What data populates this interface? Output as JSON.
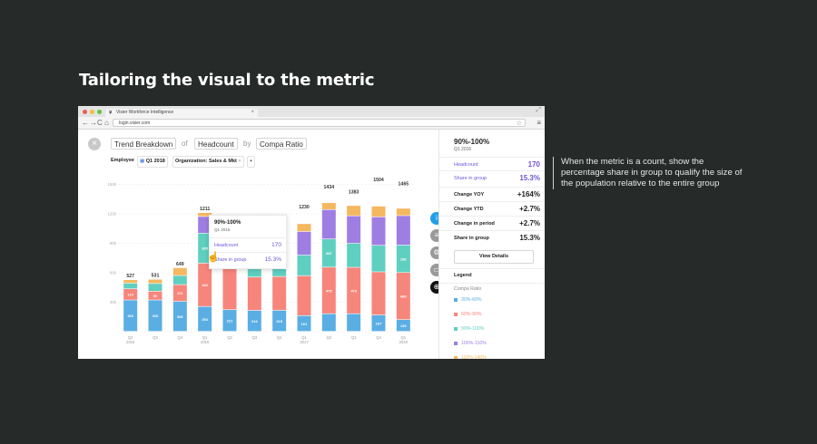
{
  "slide": {
    "title": "Tailoring the visual to the metric",
    "note": "When the metric is a count, show the percentage share in group to qualify the size of the population relative to the entire group"
  },
  "browser": {
    "tab_title": "Visier Workforce Intelligence",
    "url": "login.visier.com"
  },
  "toolbar": {
    "chart_type": "Trend Breakdown",
    "of": "of",
    "metric": "Headcount",
    "by": "by",
    "dimension": "Compa Ratio"
  },
  "filters": {
    "employee": "Employee",
    "period": "Q1 2018",
    "organization": "Organization: Sales & Mkt",
    "add": "+"
  },
  "chart_data": {
    "type": "bar",
    "stacked": true,
    "categories": [
      "Q2 2015",
      "Q3",
      "Q4",
      "Q1 2016",
      "Q2",
      "Q3",
      "Q4",
      "Q1 2017",
      "Q2",
      "Q3",
      "Q4",
      "Q1 2018"
    ],
    "x_tick_lines": [
      [
        "Q2",
        "2015"
      ],
      [
        "Q3",
        ""
      ],
      [
        "Q4",
        ""
      ],
      [
        "Q1",
        "2016"
      ],
      [
        "Q2",
        ""
      ],
      [
        "Q3",
        ""
      ],
      [
        "Q4",
        ""
      ],
      [
        "Q1",
        "2017"
      ],
      [
        "Q2",
        ""
      ],
      [
        "Q3",
        ""
      ],
      [
        "Q4",
        ""
      ],
      [
        "Q1",
        "2018"
      ]
    ],
    "totals": [
      "527",
      "531",
      "649",
      "1211",
      "",
      "",
      "",
      "1230",
      "1434",
      "1383",
      "1504",
      "1465"
    ],
    "total_values": [
      527,
      531,
      649,
      1211,
      1150,
      1100,
      1180,
      1230,
      1434,
      1383,
      1504,
      1465
    ],
    "yticks": [
      {
        "value": 0,
        "label": ""
      },
      {
        "value": 300,
        "label": "300"
      },
      {
        "value": 600,
        "label": "600"
      },
      {
        "value": 900,
        "label": "900"
      },
      {
        "value": 1200,
        "label": "1200"
      },
      {
        "value": 1500,
        "label": "1500"
      }
    ],
    "ylim": [
      0,
      1700
    ],
    "grid": true,
    "series": [
      {
        "name": "30%-60%",
        "color": "#5aaee3",
        "values": [
          320,
          320,
          306,
          254,
          221,
          214,
          215,
          161,
          180,
          180,
          167,
          120
        ],
        "labels": [
          "320",
          "320",
          "306",
          "254",
          "221",
          "214",
          "215",
          "161",
          "",
          "",
          "167",
          "120"
        ]
      },
      {
        "name": "60%-90%",
        "color": "#f6867c",
        "values": [
          114,
          90,
          171,
          442,
          420,
          340,
          345,
          407,
          475,
          473,
          440,
          480
        ],
        "labels": [
          "114",
          "90",
          "171",
          "442",
          "",
          "",
          "",
          "",
          "475",
          "473",
          "",
          "480"
        ]
      },
      {
        "name": "90%-110%",
        "color": "#5fcfc0",
        "values": [
          57,
          78,
          92,
          305,
          150,
          160,
          170,
          210,
          287,
          245,
          270,
          280
        ],
        "labels": [
          "",
          "",
          "",
          "305",
          "150",
          "",
          "",
          "",
          "287",
          "",
          "",
          "280"
        ]
      },
      {
        "name": "100%-110%",
        "color": "#9f7ee3",
        "values": [
          0,
          0,
          0,
          170,
          130,
          200,
          210,
          240,
          300,
          280,
          290,
          300
        ],
        "labels": [
          "",
          "",
          "",
          "",
          "",
          "",
          "",
          "",
          "",
          "",
          "",
          ""
        ]
      },
      {
        "name": "110%-140%",
        "color": "#f4b860",
        "values": [
          36,
          43,
          80,
          40,
          60,
          80,
          60,
          80,
          70,
          105,
          110,
          75
        ],
        "labels": [
          "",
          "",
          "",
          "",
          "",
          "",
          "",
          "",
          "",
          "",
          "",
          ""
        ]
      }
    ]
  },
  "tooltip": {
    "title": "90%-100%",
    "period": "Q1 2016",
    "rows": [
      {
        "label": "Headcount",
        "value": "170"
      },
      {
        "label": "Share in group",
        "value": "15.3%"
      }
    ]
  },
  "panel": {
    "title": "90%-100%",
    "period": "Q1 2016",
    "highlight_rows": [
      {
        "label": "Headcount",
        "value": "170"
      },
      {
        "label": "Share in group",
        "value": "15.3%"
      }
    ],
    "metrics": [
      {
        "label": "Change YOY",
        "value": "+164%"
      },
      {
        "label": "Change YTD",
        "value": "+2.7%"
      },
      {
        "label": "Change in period",
        "value": "+2.7%"
      },
      {
        "label": "Share in group",
        "value": "15.3%"
      }
    ],
    "view_details": "View Details",
    "legend_title": "Legend",
    "legend_group": "Compa Ratio",
    "legend": [
      {
        "label": "30%-60%",
        "color": "#5aaee3"
      },
      {
        "label": "60%-90%",
        "color": "#f6867c"
      },
      {
        "label": "90%-100%",
        "color": "#5fcfc0"
      },
      {
        "label": "100%-110%",
        "color": "#9f7ee3"
      },
      {
        "label": "110%-140%",
        "color": "#f4b860"
      }
    ]
  },
  "tools": [
    {
      "icon": "info-icon",
      "glyph": "i",
      "color": "#1fa0e8"
    },
    {
      "icon": "add-list-icon",
      "glyph": "≡",
      "color": "#9a9a9a"
    },
    {
      "icon": "settings-icon",
      "glyph": "⚙",
      "color": "#9a9a9a"
    },
    {
      "icon": "print-icon",
      "glyph": "▭",
      "color": "#9a9a9a"
    },
    {
      "icon": "focus-icon",
      "glyph": "⊕",
      "color": "#111111"
    }
  ]
}
